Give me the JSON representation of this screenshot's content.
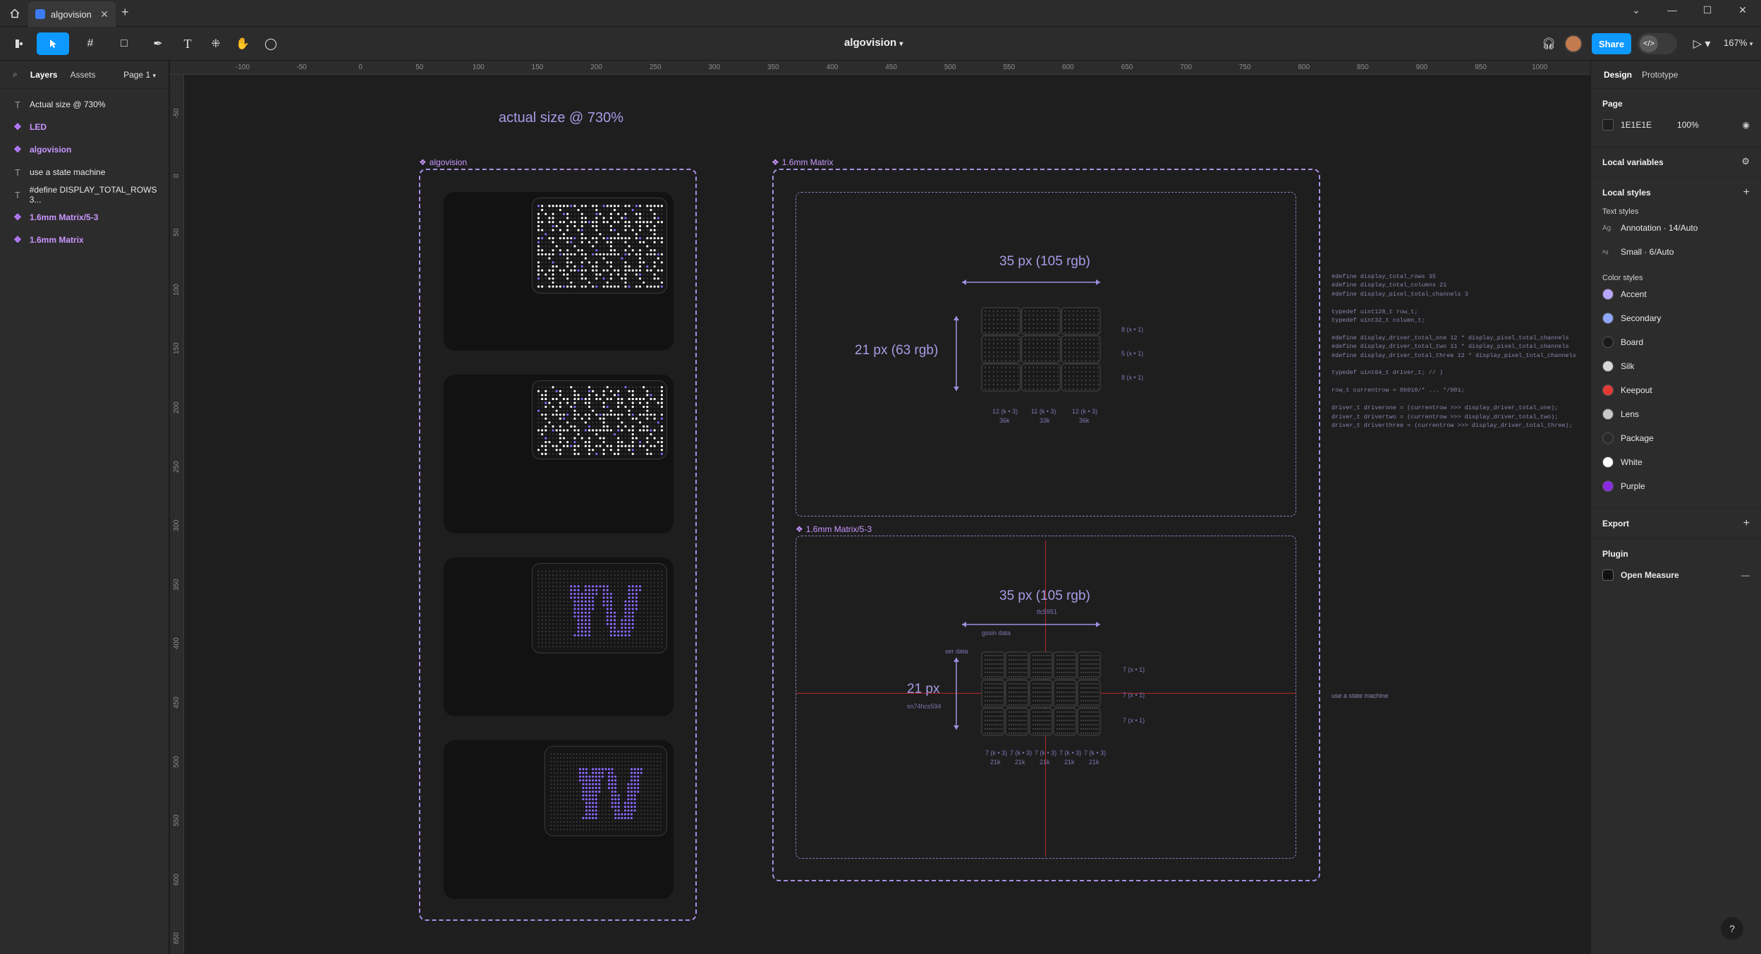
{
  "window": {
    "tab_title": "algovision",
    "tab_close": "✕",
    "new_tab": "+"
  },
  "toolbar": {
    "file_title": "algovision",
    "share_label": "Share",
    "zoom_label": "167%"
  },
  "left_panel": {
    "tabs": [
      "Layers",
      "Assets"
    ],
    "page_label": "Page 1",
    "layers": [
      {
        "label": "Actual size @ 730%",
        "type": "text"
      },
      {
        "label": "LED",
        "type": "component"
      },
      {
        "label": "algovision",
        "type": "component"
      },
      {
        "label": "use a state machine",
        "type": "text"
      },
      {
        "label": "#define DISPLAY_TOTAL_ROWS 3...",
        "type": "text"
      },
      {
        "label": "1.6mm Matrix/5-3",
        "type": "component"
      },
      {
        "label": "1.6mm Matrix",
        "type": "component"
      }
    ]
  },
  "rulers": {
    "top": [
      "-100",
      "-50",
      "0",
      "50",
      "100",
      "150",
      "200",
      "250",
      "300",
      "350",
      "400",
      "450",
      "500",
      "550",
      "600",
      "650",
      "700",
      "750",
      "800",
      "850",
      "900",
      "950",
      "1000"
    ],
    "left": [
      "-50",
      "0",
      "50",
      "100",
      "150",
      "200",
      "250",
      "300",
      "350",
      "400",
      "450",
      "500",
      "550",
      "600",
      "650"
    ]
  },
  "canvas": {
    "heading": "actual size @ 730%",
    "frame_algovision": "algovision",
    "frame_matrix": "1.6mm Matrix",
    "frame_matrix53": "1.6mm Matrix/5-3",
    "top_width_label": "35 px (105 rgb)",
    "top_height_label": "21 px (63 rgb)",
    "top_row_labels": [
      "8 (x • 1)",
      "5 (x • 1)",
      "8 (x • 1)"
    ],
    "top_col_labels": [
      "12 (k • 3)",
      "11 (k • 3)",
      "12 (k • 3)"
    ],
    "top_col_sub": [
      "36k",
      "33k",
      "36k"
    ],
    "bot_width_label": "35 px (105 rgb)",
    "bot_width_sub": "tlc5951",
    "bot_gsin": "gssin data",
    "bot_ser": "ser data",
    "bot_height_label": "21 px",
    "bot_height_sub": "sn74hcs594",
    "bot_row_labels": [
      "7 (x • 1)",
      "7 (x • 1)",
      "7 (x • 1)"
    ],
    "bot_col_labels": [
      "7 (k • 3)",
      "7 (k • 3)",
      "7 (k • 3)",
      "7 (k • 3)",
      "7 (k • 3)"
    ],
    "bot_col_sub": [
      "21k",
      "21k",
      "21k",
      "21k",
      "21k"
    ],
    "state_machine_note": "use a state machine",
    "code_block": "#define display_total_rows 35\n#define display_total_columns 21\n#define display_pixel_total_channels 3\n\ntypedef uint128_t row_t;\ntypedef uint32_t column_t;\n\n#define display_driver_total_one 12 * display_pixel_total_channels\n#define display_driver_total_two 11 * display_pixel_total_channels\n#define display_driver_total_three 12 * display_pixel_total_channels\n\ntypedef uint64_t driver_t; // )\n\nrow_t currentrow = 0b010/* ... */001;\n\ndriver_t driverone = (currentrow >>> display_driver_total_one);\ndriver_t drivertwo = (currentrow >>> display_driver_total_two);\ndriver_t driverthree = (currentrow >>> display_driver_total_three);"
  },
  "right_panel": {
    "tabs": [
      "Design",
      "Prototype"
    ],
    "page_heading": "Page",
    "page_color": "1E1E1E",
    "page_opacity": "100%",
    "local_variables": "Local variables",
    "local_styles": "Local styles",
    "text_styles_heading": "Text styles",
    "text_styles": [
      {
        "icon": "Ag",
        "label": "Annotation · 14/Auto"
      },
      {
        "icon": "Ag",
        "label": "Small · 6/Auto"
      }
    ],
    "color_styles_heading": "Color styles",
    "color_styles": [
      {
        "label": "Accent",
        "color": "#b9a6ff"
      },
      {
        "label": "Secondary",
        "color": "#8fa8ff"
      },
      {
        "label": "Board",
        "color": "#1a1a1a"
      },
      {
        "label": "Silk",
        "color": "#d8d8d8"
      },
      {
        "label": "Keepout",
        "color": "#e53935"
      },
      {
        "label": "Lens",
        "color": "#c8c8c8"
      },
      {
        "label": "Package",
        "color": "#2a2a2a"
      },
      {
        "label": "White",
        "color": "#ffffff"
      },
      {
        "label": "Purple",
        "color": "#8a2be2"
      }
    ],
    "export_heading": "Export",
    "plugin_heading": "Plugin",
    "plugin_name": "Open Measure",
    "help": "?"
  },
  "colors": {
    "accent_blue": "#0d99ff",
    "frame_purple": "#a98fe6",
    "guide_red": "#b3262b"
  }
}
